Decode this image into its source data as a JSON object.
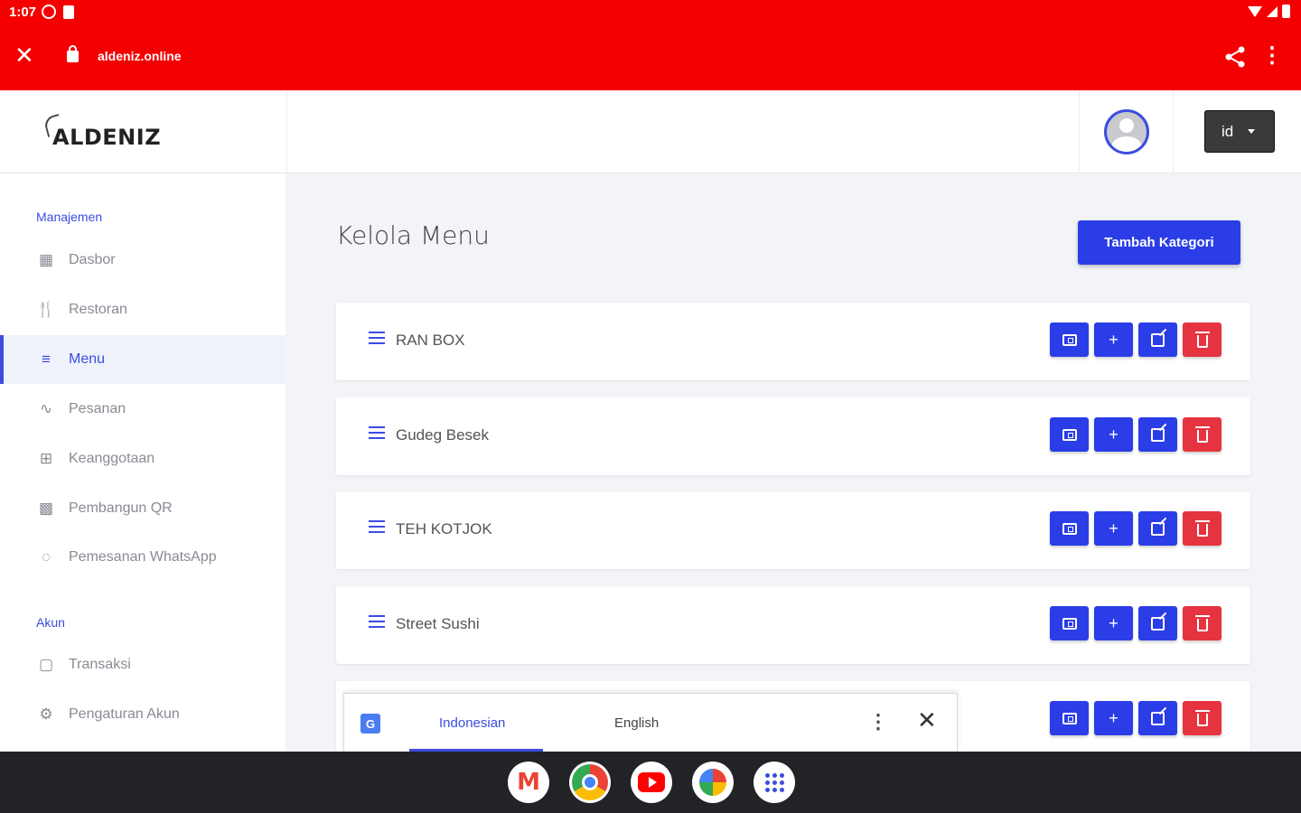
{
  "status_bar": {
    "time": "1:07"
  },
  "browser": {
    "url": "aldeniz.online"
  },
  "header": {
    "logo": "ALDENIZ",
    "language": "id"
  },
  "sidebar": {
    "section_management": "Manajemen",
    "section_account": "Akun",
    "items": [
      {
        "label": "Dasbor",
        "icon": "grid-icon"
      },
      {
        "label": "Restoran",
        "icon": "fork-knife-icon"
      },
      {
        "label": "Menu",
        "icon": "list-icon"
      },
      {
        "label": "Pesanan",
        "icon": "activity-icon"
      },
      {
        "label": "Keanggotaan",
        "icon": "gift-icon"
      },
      {
        "label": "Pembangun QR",
        "icon": "qr-icon"
      },
      {
        "label": "Pemesanan WhatsApp",
        "icon": "whatsapp-icon"
      }
    ],
    "account_items": [
      {
        "label": "Transaksi",
        "icon": "document-icon"
      },
      {
        "label": "Pengaturan Akun",
        "icon": "gear-icon"
      }
    ]
  },
  "main": {
    "title": "Kelola Menu",
    "add_category": "Tambah Kategori",
    "categories": [
      {
        "name": "RAN BOX"
      },
      {
        "name": "Gudeg Besek"
      },
      {
        "name": "TEH KOTJOK"
      },
      {
        "name": "Street Sushi"
      },
      {
        "name": ""
      }
    ]
  },
  "translate_bar": {
    "source": "Indonesian",
    "target": "English"
  },
  "colors": {
    "browser_red": "#f50000",
    "accent_blue": "#2a3de6",
    "danger_red": "#e53440"
  }
}
